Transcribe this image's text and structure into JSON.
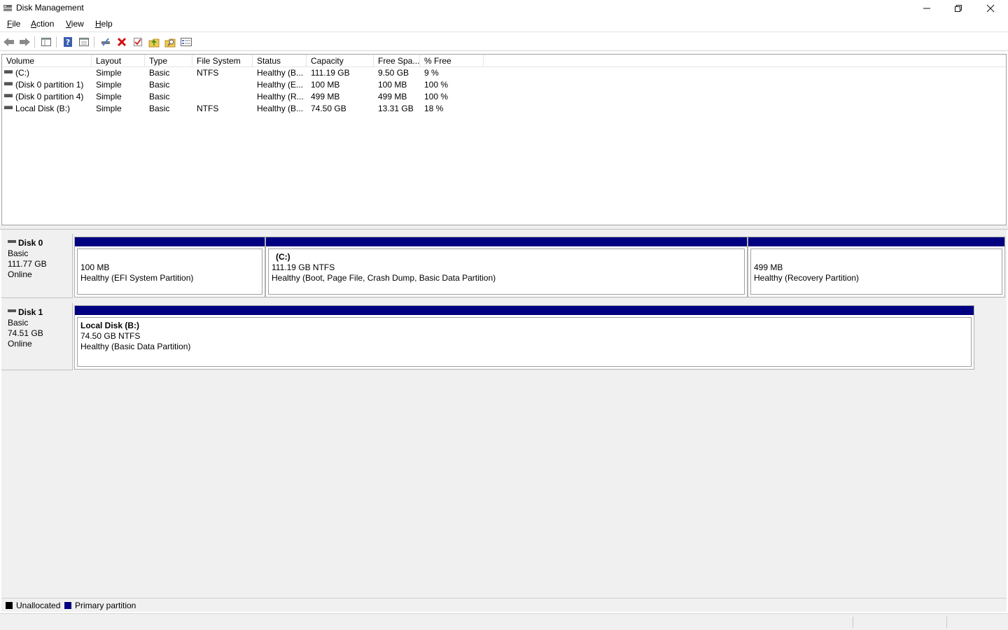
{
  "window": {
    "title": "Disk Management",
    "controls": {
      "minimize": "—",
      "restore": "❐",
      "close": "✕"
    }
  },
  "menu": [
    {
      "label": "File",
      "accel": "F",
      "rest": "ile"
    },
    {
      "label": "Action",
      "accel": "A",
      "rest": "ction"
    },
    {
      "label": "View",
      "accel": "V",
      "rest": "iew"
    },
    {
      "label": "Help",
      "accel": "H",
      "rest": "elp"
    }
  ],
  "toolbar": {
    "icons": [
      "back-icon",
      "forward-icon",
      "show-hide-console-tree-icon",
      "help-icon",
      "properties-icon",
      "connect-virtual-disk-icon",
      "delete-icon",
      "check-icon",
      "rescan-icon",
      "search-icon",
      "settings-list-icon"
    ]
  },
  "volume_list": {
    "columns": [
      "Volume",
      "Layout",
      "Type",
      "File System",
      "Status",
      "Capacity",
      "Free Spa...",
      "% Free"
    ],
    "rows": [
      [
        "(C:)",
        "Simple",
        "Basic",
        "NTFS",
        "Healthy (B...",
        "111.19 GB",
        "9.50 GB",
        "9 %"
      ],
      [
        "(Disk 0 partition 1)",
        "Simple",
        "Basic",
        "",
        "Healthy (E...",
        "100 MB",
        "100 MB",
        "100 %"
      ],
      [
        "(Disk 0 partition 4)",
        "Simple",
        "Basic",
        "",
        "Healthy (R...",
        "499 MB",
        "499 MB",
        "100 %"
      ],
      [
        "Local Disk (B:)",
        "Simple",
        "Basic",
        "NTFS",
        "Healthy (B...",
        "74.50 GB",
        "13.31 GB",
        "18 %"
      ]
    ]
  },
  "disks": [
    {
      "name": "Disk 0",
      "type": "Basic",
      "size": "111.77 GB",
      "state": "Online",
      "partitions": [
        {
          "title": "",
          "size": "100 MB",
          "status": "Healthy (EFI System Partition)"
        },
        {
          "title": "(C:)",
          "size": "111.19 GB NTFS",
          "status": "Healthy (Boot, Page File, Crash Dump, Basic Data Partition)"
        },
        {
          "title": "",
          "size": "499 MB",
          "status": "Healthy (Recovery Partition)"
        }
      ]
    },
    {
      "name": "Disk 1",
      "type": "Basic",
      "size": "74.51 GB",
      "state": "Online",
      "partitions": [
        {
          "title": "Local Disk  (B:)",
          "size": "74.50 GB NTFS",
          "status": "Healthy (Basic Data Partition)"
        }
      ]
    }
  ],
  "legend": [
    {
      "label": "Unallocated",
      "color": "#000000"
    },
    {
      "label": "Primary partition",
      "color": "#000080"
    }
  ]
}
